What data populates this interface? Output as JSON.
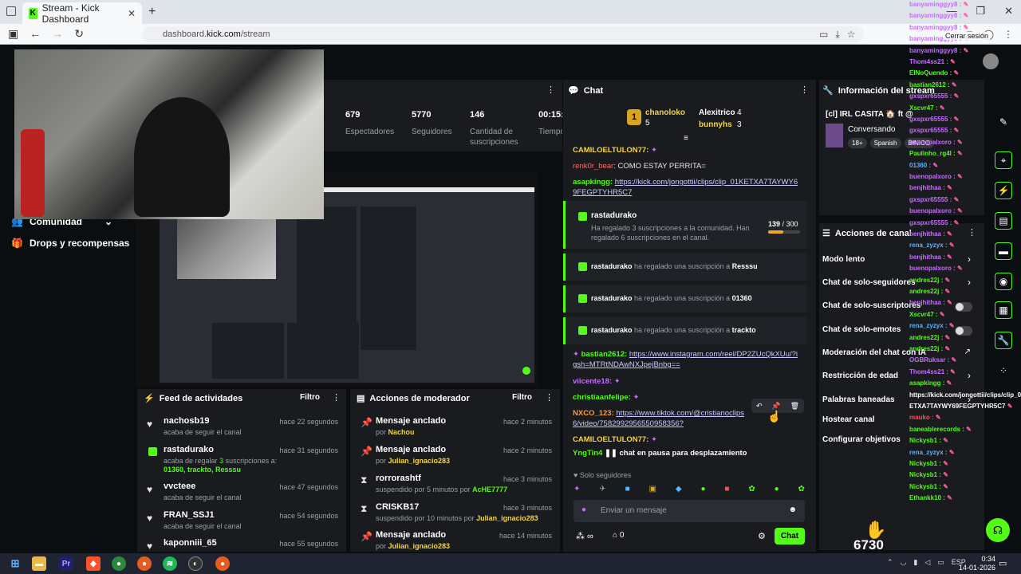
{
  "browser": {
    "tab_title": "Stream - Kick Dashboard",
    "url_domain": "dashboard.",
    "url_host": "kick.com",
    "url_path": "/stream",
    "sign_out_label": "Cerrar sesión"
  },
  "sidebar": {
    "items": [
      {
        "label": "Comunidad",
        "icon": "users-icon"
      },
      {
        "label": "Drops y recompensas",
        "icon": "gift-icon"
      }
    ]
  },
  "stats": [
    {
      "value": "679",
      "label": "Espectadores"
    },
    {
      "value": "5770",
      "label": "Seguidores"
    },
    {
      "value": "146",
      "label": "Cantidad de suscripciones"
    },
    {
      "value": "00:15:",
      "label": "Tiempo en vivo"
    }
  ],
  "activity_feed": {
    "title": "Feed de actividades",
    "filter": "Filtro",
    "rows": [
      {
        "name": "nachosb19",
        "sub": "acaba de seguir el canal",
        "time": "hace 22 segundos",
        "icon": "heart-icon"
      },
      {
        "name": "rastadurako",
        "sub": "acaba de regalar",
        "count": "3",
        "sub2": "suscripciones a:",
        "targets": "01360, trackto, Resssu",
        "time": "hace 31 segundos",
        "icon": "gift-icon"
      },
      {
        "name": "vvcteee",
        "sub": "acaba de seguir el canal",
        "time": "hace 47 segundos",
        "icon": "heart-icon"
      },
      {
        "name": "FRAN_SSJ1",
        "sub": "acaba de seguir el canal",
        "time": "hace 54 segundos",
        "icon": "heart-icon"
      },
      {
        "name": "kaponniii_65",
        "sub": "",
        "time": "hace 55 segundos",
        "icon": "heart-icon"
      }
    ]
  },
  "mod_actions": {
    "title": "Acciones de moderador",
    "filter": "Filtro",
    "rows": [
      {
        "name": "Mensaje anclado",
        "by": "por",
        "who": "Nachou",
        "time": "hace 2 minutos",
        "icon": "pin-icon"
      },
      {
        "name": "Mensaje anclado",
        "by": "por",
        "who": "Julian_ignacio283",
        "time": "hace 2 minutos",
        "icon": "pin-icon"
      },
      {
        "name": "rorrorashtf",
        "by": "suspendido por 5 minutos por",
        "who": "AcHE7777",
        "time": "hace 3 minutos",
        "icon": "hourglass-icon"
      },
      {
        "name": "CRISKB17",
        "by": "suspendido por 10 minutos por",
        "who": "Julian_ignacio283",
        "time": "hace 3 minutos",
        "icon": "hourglass-icon"
      },
      {
        "name": "Mensaje anclado",
        "by": "por",
        "who": "Julian_ignacio283",
        "time": "hace 14 minutos",
        "icon": "pin-icon"
      }
    ]
  },
  "chat": {
    "title": "Chat",
    "leaderboard": {
      "first_name": "chanoloko",
      "first_count": "5",
      "second_name": "Alexitrico",
      "second_count": "4",
      "third_name": "bunnyhs",
      "third_count": "3",
      "rank": "1"
    },
    "messages": [
      {
        "user": "CAMILOELTULON77:",
        "text": "",
        "color": "#f5d442"
      },
      {
        "user": "renk0r_bear",
        "text": ": COMO ESTAY PERRITA=",
        "color": "#ff6b6b"
      },
      {
        "user": "asapkingg:",
        "text": "https://kick.com/jongottii/clips/clip_01KETXA7TAYWY69FEGPTYHR5C7",
        "color": "#53fc18"
      },
      {
        "user": "bastian2612:",
        "text": "https://www.instagram.com/reel/DP2ZUcQkXUu/?igsh=MTRtNDAwNXJpejBnbg==",
        "color": "#53fc18"
      },
      {
        "user": "viicente18:",
        "text": "",
        "color": "#c56cff"
      },
      {
        "user": "christiaanfelipe:",
        "text": "",
        "color": "#53fc18"
      },
      {
        "user": "NXCO_123:",
        "text": "https://www.tiktok.com/@cristianoclips6/video/7582992956550958356?",
        "color": "#ff9a3c"
      },
      {
        "user": "CAMILOELTULON77:",
        "text": "",
        "color": "#f5d442"
      },
      {
        "user": "YngTin4",
        "text": "chat en pausa para desplazamiento",
        "color": "#53fc18"
      }
    ],
    "sub_event": {
      "user": "rastadurako",
      "line1": "Ha regalado 3 suscripciones a la comunidad. Han regalado 6 suscripciones en el canal.",
      "progress_label": "139",
      "progress_total": "/ 300",
      "progress": 0.463
    },
    "gifts": [
      {
        "user": "rastadurako",
        "text": "ha regalado una suscripción a",
        "target": "Resssu"
      },
      {
        "user": "rastadurako",
        "text": "ha regalado una suscripción a",
        "target": "01360"
      },
      {
        "user": "rastadurako",
        "text": "ha regalado una suscripción a",
        "target": "trackto"
      }
    ],
    "followers_only": "Solo seguidores",
    "input_placeholder": "Enviar un mensaje",
    "points": "0",
    "send_label": "Chat"
  },
  "stream_info": {
    "title": "Información del stream",
    "stream_title": "[cl] IRL CASITA 🏠 ft @elkrys | !ig !casino",
    "category": "Conversando",
    "tags": [
      "18+",
      "Spanish",
      "BINICO"
    ]
  },
  "channel_actions": {
    "title": "Acciones de canal",
    "items": [
      {
        "label": "Modo lento",
        "control": "chevron"
      },
      {
        "label": "Chat de solo-seguidores",
        "control": "chevron"
      },
      {
        "label": "Chat de solo-suscriptores",
        "control": "toggle"
      },
      {
        "label": "Chat de solo-emotes",
        "control": "toggle"
      },
      {
        "label": "Moderación del chat con IA",
        "control": "external"
      },
      {
        "label": "Restricción de edad",
        "control": "chevron"
      },
      {
        "label": "Palabras baneadas",
        "control": "chevron"
      },
      {
        "label": "Hostear canal",
        "control": "none"
      },
      {
        "label": "Configurar objetivos",
        "control": "none"
      }
    ]
  },
  "overlay_chat": [
    {
      "name": "banyaminggyy8 :",
      "color": "#c56cff"
    },
    {
      "name": "banyaminggyy8 :",
      "color": "#c56cff"
    },
    {
      "name": "banyaminggyy8 :",
      "color": "#c56cff"
    },
    {
      "name": "banyaminggyy8 :",
      "color": "#c56cff"
    },
    {
      "name": "banyaminggyy8 :",
      "color": "#c56cff"
    },
    {
      "name": "Thom4ss21 :",
      "color": "#c56cff"
    },
    {
      "name": "ElNoQuendo :",
      "color": "#53fc18"
    },
    {
      "name": "bastian2612 :",
      "color": "#53fc18"
    },
    {
      "name": "gxspxr65555 :",
      "color": "#c56cff"
    },
    {
      "name": "Xscvr47 :",
      "color": "#53fc18"
    },
    {
      "name": "gxspxr65555 :",
      "color": "#c56cff"
    },
    {
      "name": "gxspxr65555 :",
      "color": "#c56cff"
    },
    {
      "name": "buenopalxoro :",
      "color": "#c56cff"
    },
    {
      "name": "Paulinho_rg4l :",
      "color": "#53fc18"
    },
    {
      "name": "01360 :",
      "color": "#5ab4ff"
    },
    {
      "name": "buenopalxoro :",
      "color": "#c56cff"
    },
    {
      "name": "benjhithaa :",
      "color": "#c56cff"
    },
    {
      "name": "gxspxr65555 :",
      "color": "#c56cff"
    },
    {
      "name": "buenopalxoro :",
      "color": "#c56cff"
    },
    {
      "name": "gxspxr65555 :",
      "color": "#c56cff"
    },
    {
      "name": "benjhithaa :",
      "color": "#c56cff"
    },
    {
      "name": "rena_zyzyx :",
      "color": "#5ab4ff"
    },
    {
      "name": "benjhithaa :",
      "color": "#c56cff"
    },
    {
      "name": "buenopalxoro :",
      "color": "#c56cff"
    },
    {
      "name": "andres22j :",
      "color": "#53fc18"
    },
    {
      "name": "andres22j :",
      "color": "#53fc18"
    },
    {
      "name": "benjhithaa :",
      "color": "#c56cff"
    },
    {
      "name": "Xscvr47 :",
      "color": "#53fc18"
    },
    {
      "name": "rena_zyzyx :",
      "color": "#5ab4ff"
    },
    {
      "name": "andres22j :",
      "color": "#53fc18"
    },
    {
      "name": "andres22j :",
      "color": "#53fc18"
    },
    {
      "name": "OGBRuksar :",
      "color": "#c56cff"
    },
    {
      "name": "Thom4ss21 :",
      "color": "#c56cff"
    },
    {
      "name": "asapkingg :",
      "color": "#53fc18"
    },
    {
      "name": "https://kick.com/jongottii/clips/clip_01K",
      "color": "#ffffff"
    },
    {
      "name": "ETXA7TAYWY69FEGPTYHR5C7",
      "color": "#ffffff"
    },
    {
      "name": "mauko :",
      "color": "#ff4d4d"
    },
    {
      "name": "baneablerecords :",
      "color": "#53fc18"
    },
    {
      "name": "Nickysb1 :",
      "color": "#53fc18"
    },
    {
      "name": "rena_zyzyx :",
      "color": "#5ab4ff"
    },
    {
      "name": "Nickysb1 :",
      "color": "#53fc18"
    },
    {
      "name": "Nickysb1 :",
      "color": "#53fc18"
    },
    {
      "name": "Nickysb1 :",
      "color": "#53fc18"
    },
    {
      "name": "Ethankk10 :",
      "color": "#53fc18"
    }
  ],
  "overlay_number": "6730",
  "taskbar": {
    "time": "0:34",
    "date": "14-01-2026",
    "lang": "ESP"
  },
  "colors": {
    "accent": "#53fc18",
    "bg": "#0b0e10",
    "panel": "#191b1f"
  }
}
